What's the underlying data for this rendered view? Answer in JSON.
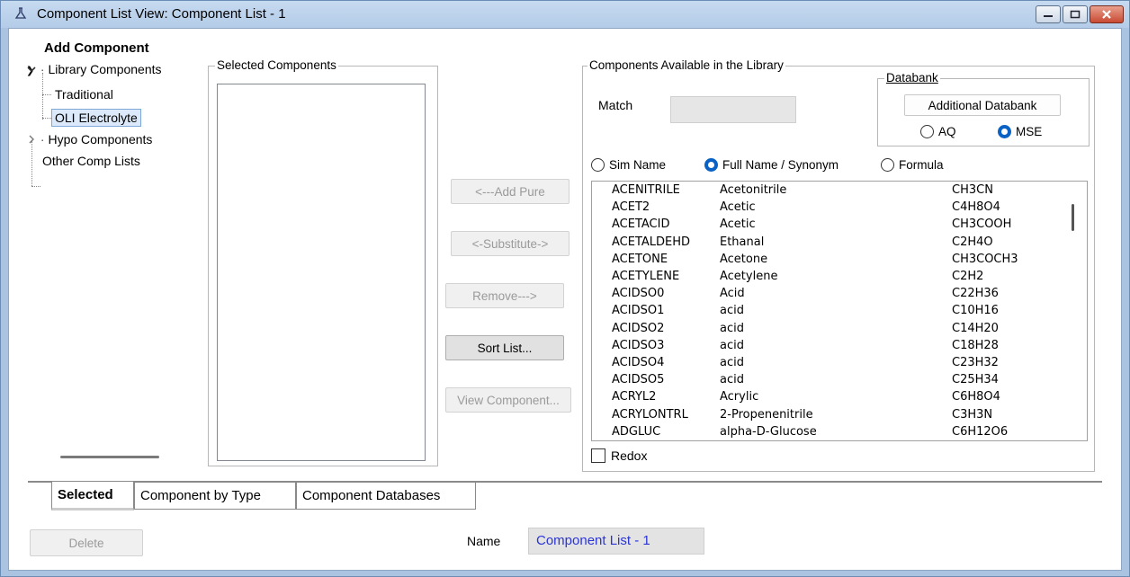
{
  "window": {
    "title": "Component List View: Component List - 1"
  },
  "add_component": {
    "title": "Add Component",
    "tree": [
      {
        "label": "Library Components",
        "expander": "collapse"
      },
      {
        "label": "Traditional"
      },
      {
        "label": "OLI Electrolyte",
        "selected": true
      },
      {
        "label": "Hypo Components",
        "expander": "expand"
      },
      {
        "label": "Other Comp Lists"
      }
    ]
  },
  "selected_components": {
    "legend": "Selected Components"
  },
  "actions": {
    "add_pure": "<---Add Pure",
    "substitute": "<-Substitute->",
    "remove": "Remove--->",
    "sort_list": "Sort List...",
    "view_component": "View Component..."
  },
  "library": {
    "legend": "Components Available in the Library",
    "match_label": "Match",
    "match_value": "",
    "databank": {
      "legend": "Databank",
      "additional_button": "Additional Databank",
      "aq_label": "AQ",
      "mse_label": "MSE",
      "selected": "MSE"
    },
    "name_mode": {
      "sim_name": "Sim Name",
      "full_name": "Full Name / Synonym",
      "formula": "Formula",
      "selected": "Full Name / Synonym"
    },
    "components": [
      {
        "sim": "ACENITRILE",
        "name": "Acetonitrile",
        "formula": "CH3CN"
      },
      {
        "sim": "ACET2",
        "name": "Acetic",
        "formula": "C4H8O4"
      },
      {
        "sim": "ACETACID",
        "name": "Acetic",
        "formula": "CH3COOH"
      },
      {
        "sim": "ACETALDEHD",
        "name": "Ethanal",
        "formula": "C2H4O"
      },
      {
        "sim": "ACETONE",
        "name": "Acetone",
        "formula": "CH3COCH3"
      },
      {
        "sim": "ACETYLENE",
        "name": "Acetylene",
        "formula": "C2H2"
      },
      {
        "sim": "ACIDSO0",
        "name": "Acid",
        "formula": "C22H36"
      },
      {
        "sim": "ACIDSO1",
        "name": "acid",
        "formula": "C10H16"
      },
      {
        "sim": "ACIDSO2",
        "name": "acid",
        "formula": "C14H20"
      },
      {
        "sim": "ACIDSO3",
        "name": "acid",
        "formula": "C18H28"
      },
      {
        "sim": "ACIDSO4",
        "name": "acid",
        "formula": "C23H32"
      },
      {
        "sim": "ACIDSO5",
        "name": "acid",
        "formula": "C25H34"
      },
      {
        "sim": "ACRYL2",
        "name": "Acrylic",
        "formula": "C6H8O4"
      },
      {
        "sim": "ACRYLONTRL",
        "name": "2-Propenenitrile",
        "formula": "C3H3N"
      },
      {
        "sim": "ADGLUC",
        "name": "alpha-D-Glucose",
        "formula": "C6H12O6"
      }
    ],
    "redox_label": "Redox"
  },
  "tabs": [
    {
      "label": "Selected",
      "active": true
    },
    {
      "label": "Component by Type"
    },
    {
      "label": "Component Databases"
    }
  ],
  "footer": {
    "delete_label": "Delete",
    "name_label": "Name",
    "name_value": "Component List - 1"
  },
  "colors": {
    "accent": "#0b62c4",
    "name_text": "#2b35d6",
    "frame": "#a9c3e0"
  }
}
